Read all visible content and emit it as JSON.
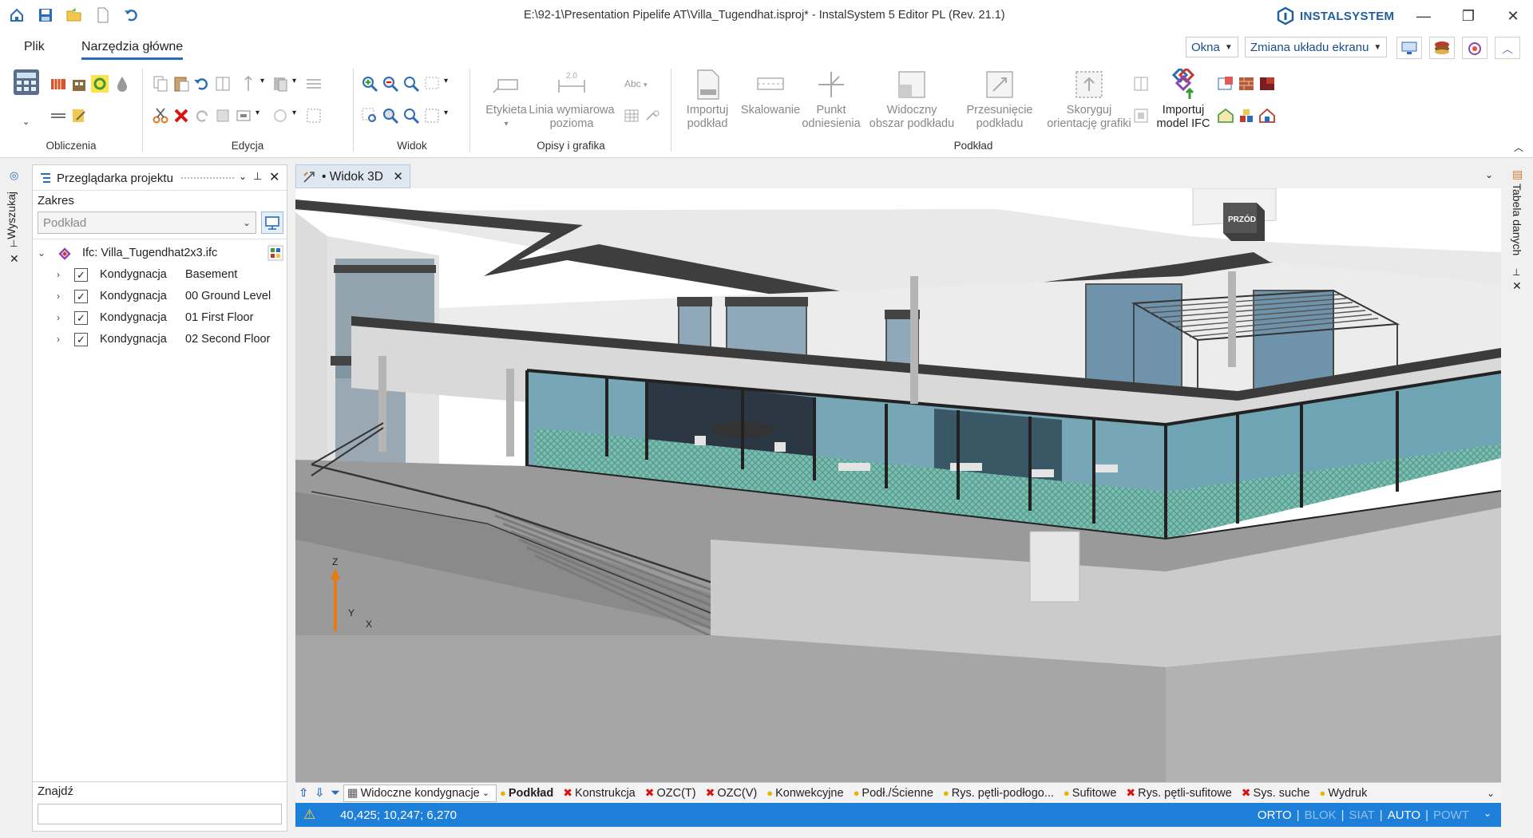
{
  "window": {
    "title": "E:\\92-1\\Presentation Pipelife AT\\Villa_Tugendhat.isproj* - InstalSystem 5 Editor PL (Rev. 21.1)",
    "brand": "INSTALSYSTEM"
  },
  "tabs": {
    "plik": "Plik",
    "narzedzia": "Narzędzia główne"
  },
  "top_right": {
    "okna": "Okna",
    "zmiana": "Zmiana układu ekranu"
  },
  "ribbon": {
    "groups": {
      "obliczenia": "Obliczenia",
      "edycja": "Edycja",
      "widok": "Widok",
      "opisy": "Opisy i grafika",
      "podklad": "Podkład"
    },
    "buttons": {
      "etykieta": "Etykieta",
      "linia1": "Linia wymiarowa",
      "linia2": "pozioma",
      "importuj_podklad1": "Importuj",
      "importuj_podklad2": "podkład",
      "skalowanie": "Skalowanie",
      "punkt1": "Punkt",
      "punkt2": "odniesienia",
      "widoczny1": "Widoczny",
      "widoczny2": "obszar podkładu",
      "przesuniecie1": "Przesunięcie",
      "przesuniecie2": "podkładu",
      "skoryguj1": "Skoryguj",
      "skoryguj2": "orientację grafiki",
      "ifc1": "Importuj",
      "ifc2": "model IFC",
      "abc": "Abc",
      "dim_value": "2.0"
    }
  },
  "left_strip": {
    "label": "Wyszukaj"
  },
  "right_strip": {
    "label": "Tabela danych"
  },
  "browser": {
    "title": "Przeglądarka projektu",
    "zakres_label": "Zakres",
    "zakres_value": "Podkład",
    "root": "Ifc: Villa_Tugendhat2x3.ifc",
    "items": [
      {
        "kind": "Kondygnacja",
        "name": "Basement"
      },
      {
        "kind": "Kondygnacja",
        "name": "00 Ground Level"
      },
      {
        "kind": "Kondygnacja",
        "name": "01 First Floor"
      },
      {
        "kind": "Kondygnacja",
        "name": "02 Second Floor"
      }
    ],
    "find_label": "Znajdź"
  },
  "doc_tab": {
    "label": "• Widok 3D"
  },
  "viewcube": {
    "label": "PRZÓD"
  },
  "axes": {
    "z": "Z",
    "y": "Y",
    "x": "X"
  },
  "filter_bar": {
    "visible_floors": "Widoczne kondygnacje",
    "items": [
      {
        "label": "Podkład",
        "state": "on",
        "bold": true
      },
      {
        "label": "Konstrukcja",
        "state": "off"
      },
      {
        "label": "OZC(T)",
        "state": "off"
      },
      {
        "label": "OZC(V)",
        "state": "off"
      },
      {
        "label": "Konwekcyjne",
        "state": "on"
      },
      {
        "label": "Podł./Ścienne",
        "state": "on"
      },
      {
        "label": "Rys. pętli-podłogo...",
        "state": "on"
      },
      {
        "label": "Sufitowe",
        "state": "on"
      },
      {
        "label": "Rys. pętli-sufitowe",
        "state": "off"
      },
      {
        "label": "Sys. suche",
        "state": "off"
      },
      {
        "label": "Wydruk",
        "state": "on"
      }
    ]
  },
  "status": {
    "coords": "40,425; 10,247; 6,270",
    "modes": [
      {
        "label": "ORTO",
        "on": true
      },
      {
        "label": "BLOK",
        "on": false
      },
      {
        "label": "SIAT",
        "on": false
      },
      {
        "label": "AUTO",
        "on": true
      },
      {
        "label": "POWT",
        "on": false
      }
    ]
  }
}
